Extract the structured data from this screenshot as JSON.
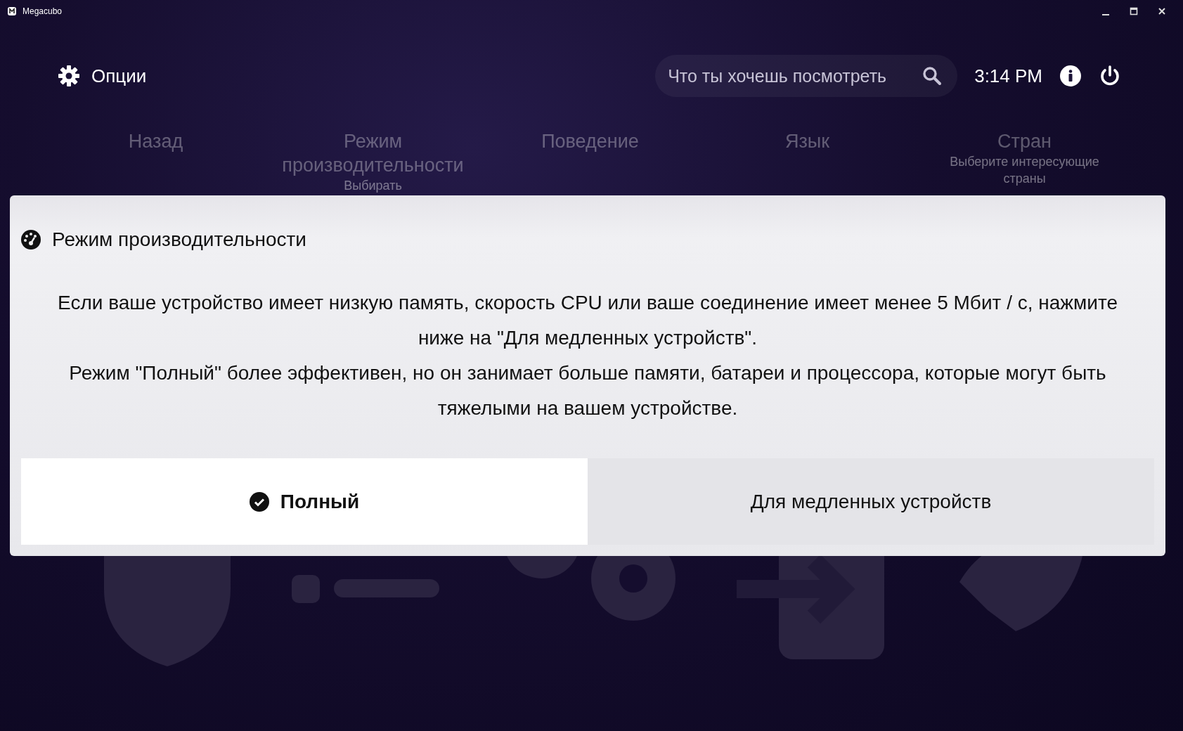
{
  "window": {
    "title": "Megacubo"
  },
  "header": {
    "title": "Опции",
    "search": {
      "placeholder": "Что ты хочешь посмотреть"
    },
    "time": "3:14 PM"
  },
  "menu": [
    {
      "label": "Назад"
    },
    {
      "label": "Режим производительности",
      "subtitle": "Выбирать"
    },
    {
      "label": "Поведение"
    },
    {
      "label": "Язык"
    },
    {
      "label": "Стран",
      "subtitle": "Выберите интересующие страны"
    }
  ],
  "dialog": {
    "title": "Режим производительности",
    "message": "Если ваше устройство имеет низкую память, скорость CPU или ваше соединение имеет менее 5 Мбит / с, нажмите ниже на \"Для медленных устройств\".\nРежим \"Полный\" более эффективен, но он занимает больше памяти, батареи и процессора, которые могут быть тяжелыми на вашем устройстве.",
    "options": [
      {
        "label": "Полный",
        "selected": true
      },
      {
        "label": "Для медленных устройств",
        "selected": false
      }
    ]
  }
}
